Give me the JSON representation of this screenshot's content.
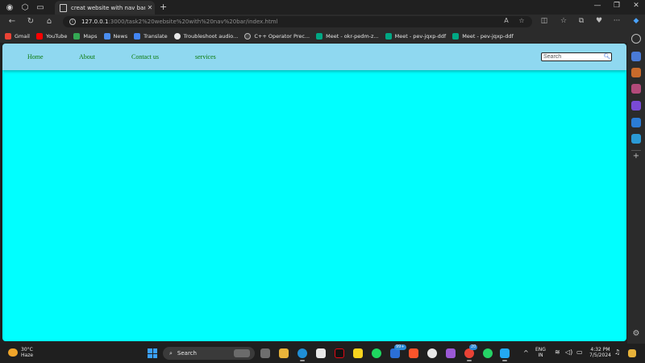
{
  "browser": {
    "tab_title": "creat website with nav bar",
    "url_host": "127.0.0.1",
    "url_path": ":3000/task2%20website%20with%20nav%20bar/index.html"
  },
  "bookmarks": [
    {
      "label": "Gmail",
      "color": "#ea4335"
    },
    {
      "label": "YouTube",
      "color": "#ff0000"
    },
    {
      "label": "Maps",
      "color": "#34a853"
    },
    {
      "label": "News",
      "color": "#4a8df0"
    },
    {
      "label": "Translate",
      "color": "#4285f4"
    },
    {
      "label": "Troubleshoot audio...",
      "color": "#e8e8e8"
    },
    {
      "label": "C++ Operator Prec...",
      "color": "#444444"
    },
    {
      "label": "Meet - okr-pedm-z...",
      "color": "#00a884"
    },
    {
      "label": "Meet - pev-jqxp-ddf",
      "color": "#00a884"
    },
    {
      "label": "Meet - pev-jqxp-ddf",
      "color": "#00a884"
    }
  ],
  "page": {
    "background": "#00ffff",
    "navbar_background": "#8fd8f0",
    "link_color": "#0a7a0a",
    "nav_links": [
      "Home",
      "About",
      "Contact us",
      "services"
    ],
    "search_placeholder": "Search"
  },
  "taskbar": {
    "weather_temp": "30°C",
    "weather_desc": "Haze",
    "search_label": "Search",
    "lang_line1": "ENG",
    "lang_line2": "IN",
    "time": "4:32 PM",
    "date": "7/5/2024",
    "badge_teams": "99+",
    "badge_whatsapp": "20"
  }
}
